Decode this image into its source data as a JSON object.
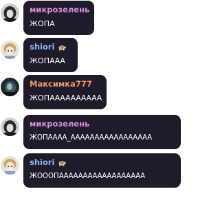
{
  "messages": [
    {
      "author": "микрозелень",
      "author_color": "#d98ee0",
      "text": "ЖОПА",
      "avatar_icon": "dark-haired-avatar-icon",
      "badge_icon": null
    },
    {
      "author": "shiori",
      "author_color": "#8fb8f0",
      "text": "ЖОПААА",
      "avatar_icon": "anime-girl-avatar-icon",
      "badge_icon": "turtle-badge-icon"
    },
    {
      "author": "Максимка777",
      "author_color": "#f09a62",
      "text": "ЖОПАААААААААА",
      "avatar_icon": "dark-teal-avatar-icon",
      "badge_icon": null
    },
    {
      "author": "микрозелень",
      "author_color": "#d98ee0",
      "text": "ЖОПАААА_ААААААААААААААААА",
      "avatar_icon": "dark-haired-avatar-icon",
      "badge_icon": null
    },
    {
      "author": "shiori",
      "author_color": "#8fb8f0",
      "text": "ЖОООПАААААААААААААААААА",
      "avatar_icon": "anime-girl-avatar-icon",
      "badge_icon": "turtle-badge-icon"
    }
  ],
  "colors": {
    "bubble_background": "#1f1b2b",
    "message_text": "#ffffff"
  }
}
